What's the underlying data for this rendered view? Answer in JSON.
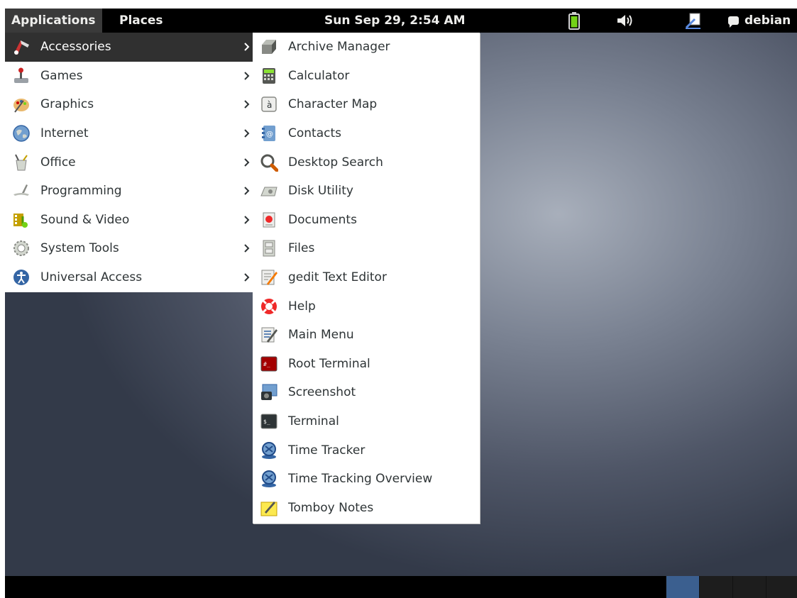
{
  "panel": {
    "applications_label": "Applications",
    "places_label": "Places",
    "clock": "Sun Sep 29,  2:54 AM",
    "user_name": "debian",
    "icons": [
      "battery-icon",
      "volume-icon",
      "user-pen-icon",
      "chat-bubble-icon"
    ]
  },
  "categories": [
    {
      "label": "Accessories",
      "icon": "accessories-icon",
      "selected": true
    },
    {
      "label": "Games",
      "icon": "games-icon"
    },
    {
      "label": "Graphics",
      "icon": "graphics-icon"
    },
    {
      "label": "Internet",
      "icon": "internet-icon"
    },
    {
      "label": "Office",
      "icon": "office-icon"
    },
    {
      "label": "Programming",
      "icon": "programming-icon"
    },
    {
      "label": "Sound & Video",
      "icon": "sound-video-icon"
    },
    {
      "label": "System Tools",
      "icon": "system-tools-icon"
    },
    {
      "label": "Universal Access",
      "icon": "universal-access-icon"
    }
  ],
  "accessories": [
    {
      "label": "Archive Manager",
      "icon": "archive-manager-icon"
    },
    {
      "label": "Calculator",
      "icon": "calculator-icon"
    },
    {
      "label": "Character Map",
      "icon": "character-map-icon"
    },
    {
      "label": "Contacts",
      "icon": "contacts-icon"
    },
    {
      "label": "Desktop Search",
      "icon": "desktop-search-icon"
    },
    {
      "label": "Disk Utility",
      "icon": "disk-utility-icon"
    },
    {
      "label": "Documents",
      "icon": "documents-icon"
    },
    {
      "label": "Files",
      "icon": "files-icon"
    },
    {
      "label": "gedit Text Editor",
      "icon": "text-editor-icon"
    },
    {
      "label": "Help",
      "icon": "help-icon"
    },
    {
      "label": "Main Menu",
      "icon": "main-menu-icon"
    },
    {
      "label": "Root Terminal",
      "icon": "root-terminal-icon"
    },
    {
      "label": "Screenshot",
      "icon": "screenshot-icon"
    },
    {
      "label": "Terminal",
      "icon": "terminal-icon"
    },
    {
      "label": "Time Tracker",
      "icon": "time-tracker-icon"
    },
    {
      "label": "Time Tracking Overview",
      "icon": "time-tracking-overview-icon"
    },
    {
      "label": "Tomboy Notes",
      "icon": "tomboy-notes-icon"
    }
  ],
  "colors": {
    "panel_bg": "#000000",
    "menu_selected_bg": "#303030",
    "workspace_active": "#3b5f8f"
  }
}
